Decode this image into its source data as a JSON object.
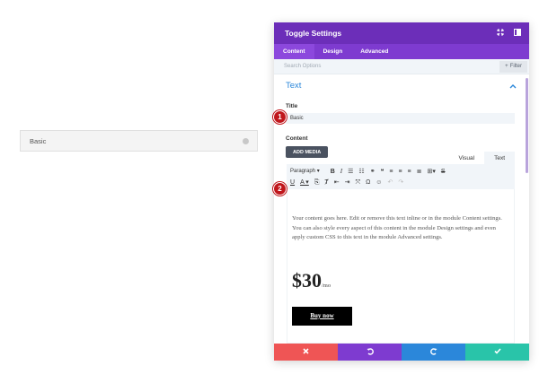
{
  "preview": {
    "toggle_title": "Basic"
  },
  "modal": {
    "title": "Toggle Settings",
    "tabs": [
      {
        "label": "Content"
      },
      {
        "label": "Design"
      },
      {
        "label": "Advanced"
      }
    ],
    "search_placeholder": "Search Options",
    "filter_label": "Filter",
    "section_title": "Text",
    "title_field": {
      "label": "Title",
      "value": "Basic"
    },
    "content_field": {
      "label": "Content",
      "add_media_label": "ADD MEDIA",
      "editor_tabs": [
        {
          "label": "Visual"
        },
        {
          "label": "Text"
        }
      ],
      "format_select": "Paragraph",
      "body_text": "Your content goes here. Edit or remove this text inline or in the module Content settings. You can also style every aspect of this content in the module Design settings and even apply custom CSS to this text in the module Advanced settings.",
      "price": "$30",
      "price_suffix": "/mo",
      "button_label": "Buy now"
    }
  },
  "markers": [
    {
      "label": "1"
    },
    {
      "label": "2"
    }
  ],
  "colors": {
    "header": "#6c2eb9",
    "tabs_bar": "#7e3bd0",
    "accent_blue": "#2b87da",
    "cancel": "#ef5555",
    "undo": "#7e3bd0",
    "redo": "#2b87da",
    "save": "#29c4a9",
    "marker": "#c0171c"
  }
}
